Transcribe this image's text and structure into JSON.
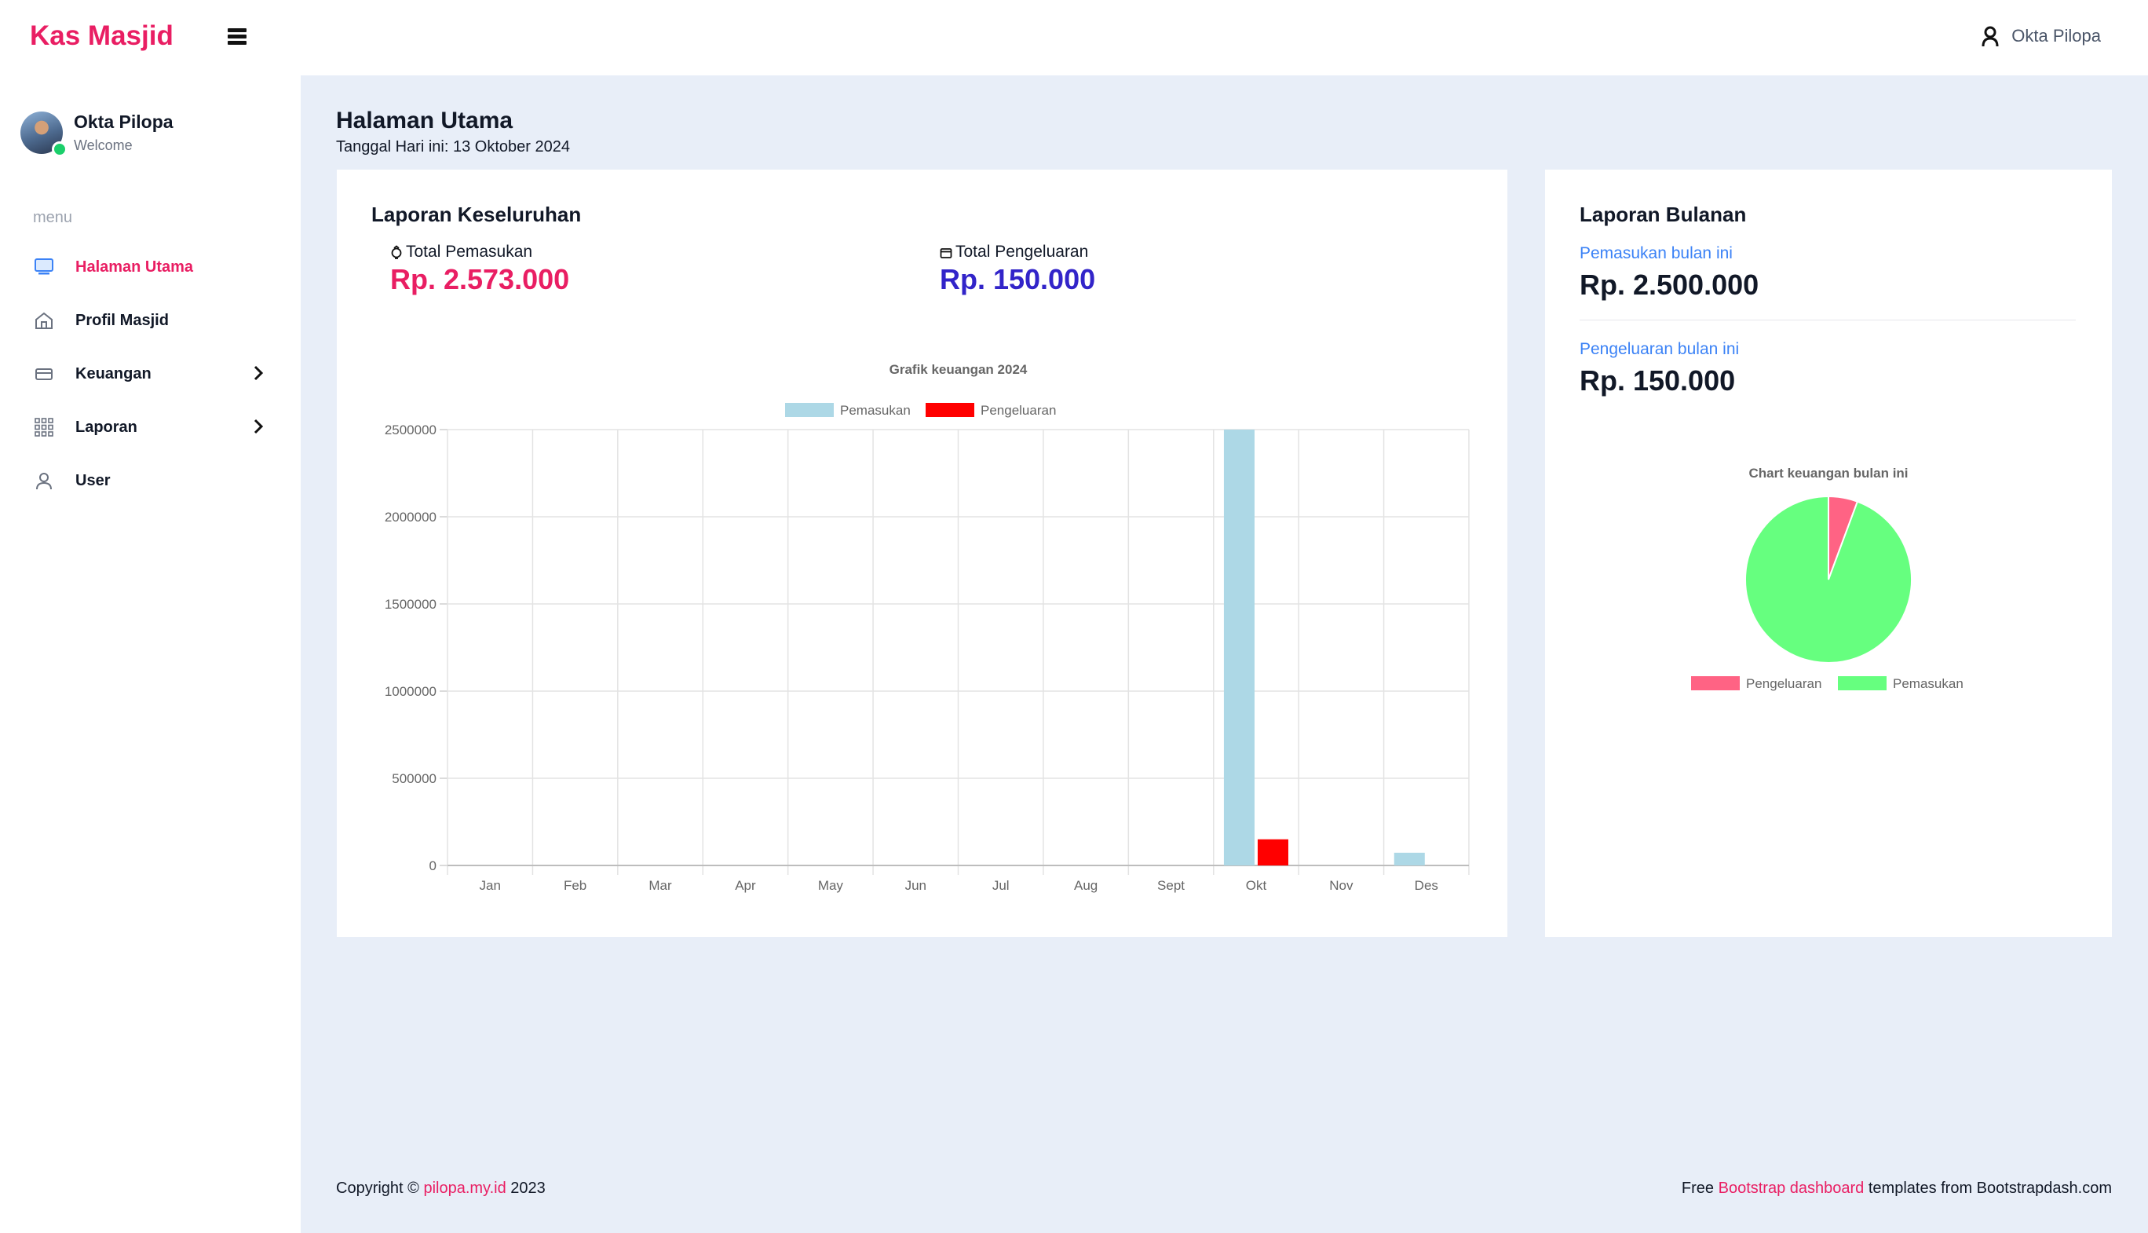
{
  "brand": "Kas Masjid",
  "topbar": {
    "user_name": "Okta Pilopa"
  },
  "sidebar": {
    "profile": {
      "name": "Okta Pilopa",
      "subtitle": "Welcome"
    },
    "menu_heading": "menu",
    "items": [
      {
        "label": "Halaman Utama",
        "icon": "monitor-icon",
        "active": true,
        "has_submenu": false
      },
      {
        "label": "Profil Masjid",
        "icon": "home-icon",
        "active": false,
        "has_submenu": false
      },
      {
        "label": "Keuangan",
        "icon": "credit-card-icon",
        "active": false,
        "has_submenu": true
      },
      {
        "label": "Laporan",
        "icon": "grid-icon",
        "active": false,
        "has_submenu": true
      },
      {
        "label": "User",
        "icon": "user-icon",
        "active": false,
        "has_submenu": false
      }
    ]
  },
  "page": {
    "title": "Halaman Utama",
    "date_line": "Tanggal Hari ini: 13 Oktober 2024"
  },
  "overview": {
    "title": "Laporan Keseluruhan",
    "income_label": "Total Pemasukan",
    "income_value": "Rp. 2.573.000",
    "expense_label": "Total Pengeluaran",
    "expense_value": "Rp. 150.000"
  },
  "monthly": {
    "title": "Laporan Bulanan",
    "income_label": "Pemasukan bulan ini",
    "income_value": "Rp. 2.500.000",
    "expense_label": "Pengeluaran bulan ini",
    "expense_value": "Rp. 150.000"
  },
  "colors": {
    "accent": "#e91e63",
    "expense_value": "#3224c9",
    "bar_income": "#add8e6",
    "bar_expense": "#ff0000",
    "pie_expense": "#ff6384",
    "pie_income": "#66ff7f"
  },
  "chart_data": [
    {
      "type": "bar",
      "title": "Grafik keuangan 2024",
      "categories": [
        "Jan",
        "Feb",
        "Mar",
        "Apr",
        "May",
        "Jun",
        "Jul",
        "Aug",
        "Sept",
        "Okt",
        "Nov",
        "Des"
      ],
      "series": [
        {
          "name": "Pemasukan",
          "values": [
            0,
            0,
            0,
            0,
            0,
            0,
            0,
            0,
            0,
            2500000,
            0,
            73000
          ]
        },
        {
          "name": "Pengeluaran",
          "values": [
            0,
            0,
            0,
            0,
            0,
            0,
            0,
            0,
            0,
            150000,
            0,
            0
          ]
        }
      ],
      "yticks": [
        "0",
        "500000",
        "1000000",
        "1500000",
        "2000000",
        "2500000"
      ],
      "ylim": [
        0,
        2500000
      ],
      "grid": true,
      "legend": "top"
    },
    {
      "type": "pie",
      "title": "Chart keuangan bulan ini",
      "labels": [
        "Pengeluaran",
        "Pemasukan"
      ],
      "values": [
        150000,
        2500000
      ],
      "legend": "bottom"
    }
  ],
  "footer": {
    "copyright_prefix": "Copyright © ",
    "copyright_link": "pilopa.my.id",
    "copyright_suffix": " 2023",
    "right_prefix": "Free ",
    "right_link": "Bootstrap dashboard",
    "right_suffix": " templates from Bootstrapdash.com"
  }
}
